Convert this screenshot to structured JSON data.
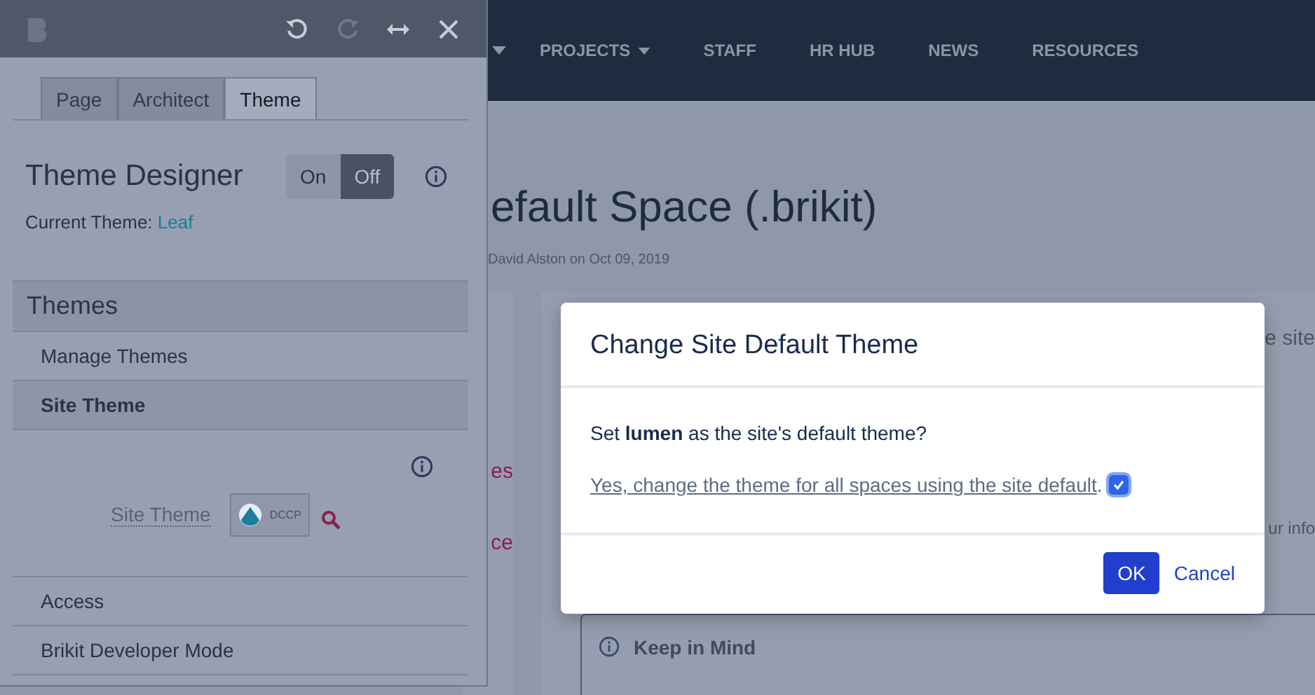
{
  "nav": {
    "items": [
      {
        "label": "PROJECTS",
        "dropdown": true
      },
      {
        "label": "STAFF",
        "dropdown": false
      },
      {
        "label": "HR HUB",
        "dropdown": false
      },
      {
        "label": "NEWS",
        "dropdown": false
      },
      {
        "label": "RESOURCES",
        "dropdown": false
      }
    ]
  },
  "page": {
    "title": "efault Space (.brikit)",
    "byline": "David Alston on Oct 09, 2019",
    "side_fragments": [
      "es",
      "ce"
    ],
    "main_fragments": [
      "e site",
      "ur info"
    ],
    "note": {
      "title": "Keep in Mind"
    }
  },
  "panel": {
    "toolbar": [
      {
        "kind": "undo",
        "disabled": false
      },
      {
        "kind": "redo",
        "disabled": true
      },
      {
        "kind": "resize",
        "disabled": false
      },
      {
        "kind": "close",
        "disabled": false
      }
    ],
    "tabs": [
      {
        "label": "Page",
        "selected": false
      },
      {
        "label": "Architect",
        "selected": false
      },
      {
        "label": "Theme",
        "selected": true
      }
    ],
    "designer": {
      "title": "Theme Designer",
      "toggle": [
        {
          "label": "On",
          "selected": false
        },
        {
          "label": "Off",
          "selected": true
        }
      ],
      "current_label": "Current Theme:",
      "current_value": "Leaf"
    },
    "section": "Themes",
    "items": [
      {
        "label": "Manage Themes",
        "selected": false
      },
      {
        "label": "Site Theme",
        "selected": true
      }
    ],
    "site_theme": {
      "label": "Site Theme",
      "badge": "DCCP"
    },
    "footer_items": [
      "Access",
      "Brikit Developer Mode"
    ]
  },
  "dialog": {
    "title": "Change Site Default Theme",
    "question": "Set **lumen** as the site's default theme?",
    "confirm": {
      "link": "Yes, change the theme for all spaces using the site default",
      "after": ".",
      "checked": true
    },
    "buttons": [
      {
        "label": "OK",
        "kind": "primary"
      },
      {
        "label": "Cancel",
        "kind": "link"
      }
    ]
  }
}
